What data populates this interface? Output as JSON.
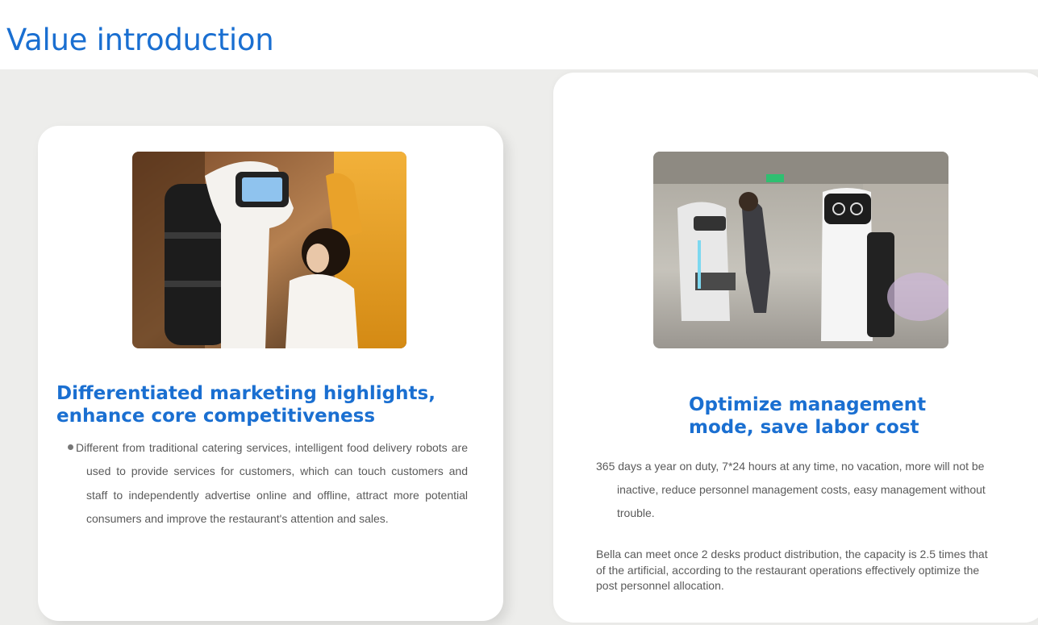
{
  "page": {
    "title": "Value introduction"
  },
  "left_card": {
    "image_icon": "photo-robot-with-child",
    "heading_line1": "Differentiated marketing highlights,",
    "heading_line2": "enhance core competitiveness",
    "body": "Different from traditional catering services, intelligent food delivery robots are used to provide services for customers, which can touch customers and staff to independently advertise online and offline, attract more potential consumers and improve the restaurant's attention and sales."
  },
  "right_card": {
    "image_icon": "photo-robots-in-restaurant",
    "heading_line1": "Optimize management",
    "heading_line2": "mode, save labor cost",
    "paragraph1": "365 days a year on duty, 7*24 hours at any time, no vacation, more will not be inactive, reduce personnel management costs, easy management without trouble.",
    "paragraph2": "Bella can meet once 2 desks product distribution, the capacity is 2.5 times that of the artificial, according to the restaurant operations effectively optimize the post personnel allocation."
  },
  "colors": {
    "accent": "#1a6fd1",
    "band": "#ededeb",
    "text": "#5a5a5a"
  }
}
